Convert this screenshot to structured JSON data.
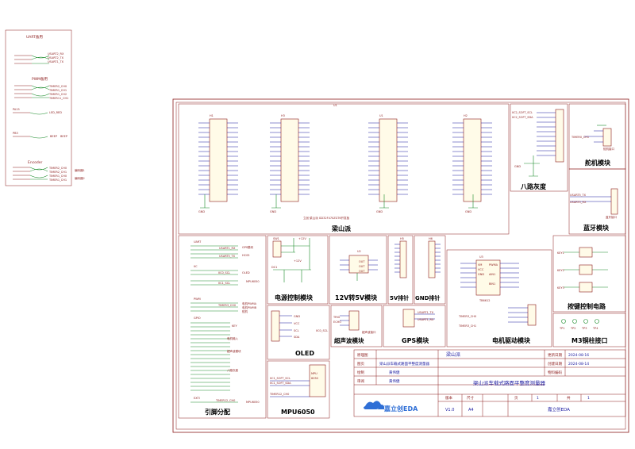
{
  "sidebar": {
    "uart_title": "UART备用",
    "pwm_title": "PWM备用",
    "led_label": "LED_RED",
    "beep_label": "BEEP",
    "encoder_title": "Encoder",
    "enc1": "编码器1",
    "enc2": "编码器2"
  },
  "blocks": {
    "liangshan": "梁山派",
    "bajing": "八路灰度",
    "servo": "舵机模块",
    "bluetooth": "蓝牙模块",
    "power": "电源控制模块",
    "v12to5": "12V转5V模块",
    "v5pin": "5V排针",
    "gndpin": "GND排针",
    "motor": "电机驱动模块",
    "keys": "按键控制电路",
    "m3": "M3铜柱接口",
    "pinmap": "引脚分配",
    "oled": "OLED",
    "ultrasonic": "超声波模块",
    "gps": "GPS模块",
    "mpu": "MPU6050"
  },
  "pinmap": {
    "uart": "UART",
    "gps": "GPS模块",
    "hc05": "HC05",
    "iic": "IIC",
    "oled": "OLED",
    "mpu": "MPU6050",
    "pwm": "PWM",
    "motor_pwm": "电机PWMA",
    "motor_pwmb": "电机PWMB",
    "servo": "舵机",
    "gpio": "GPIO",
    "key": "KEY",
    "motor_in": "电机输入",
    "ultra": "超声波模块",
    "gray": "八路灰度",
    "exti": "EXTI",
    "exti_mpu": "MPU6050"
  },
  "title_block": {
    "r1_label": "原理图",
    "r1_value": "梁山派",
    "r2_label": "图页",
    "r2_value": "梁山派车载式路面平整度测量器",
    "r3_label": "绘制",
    "r3_value": "黄伟健",
    "r4_label": "审阅",
    "r4_value": "黄伟健",
    "update_label": "更新日期",
    "update_value": "2024-08-16",
    "create_label": "创建日期",
    "create_value": "2024-08-14",
    "material_label": "物料编码",
    "material_value": "",
    "main_title": "梁山派车载式路面平整度测量器",
    "version_label": "版本",
    "version_value": "V1.0",
    "size_label": "尺寸",
    "size_value": "A4",
    "page_label": "页",
    "page_value": "1",
    "total_label": "共",
    "total_value": "1",
    "logo": "嘉立创EDA",
    "company": "嘉立创EDA"
  },
  "mcu_caption": "立创·梁山派 GD32F470ZGT6开发板"
}
